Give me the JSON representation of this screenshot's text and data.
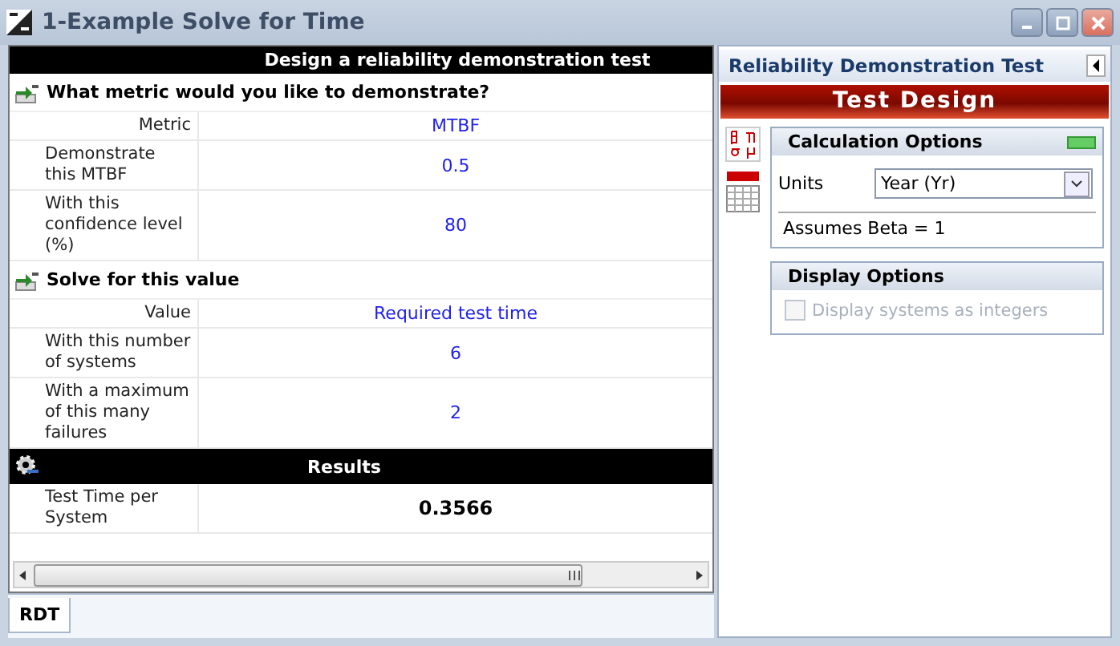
{
  "window": {
    "title": "1-Example Solve for Time"
  },
  "grid": {
    "header": "Design a reliability demonstration test",
    "sections": [
      {
        "kind": "section",
        "title": "What metric would you like to demonstrate?",
        "rows": [
          {
            "label": "Metric",
            "value": "MTBF"
          },
          {
            "label": "Demonstrate this MTBF",
            "value": "0.5"
          },
          {
            "label": "With this confidence level (%)",
            "value": "80"
          }
        ]
      },
      {
        "kind": "section",
        "title": "Solve for this value",
        "rows": [
          {
            "label": "Value",
            "value": "Required test time"
          },
          {
            "label": "With this number of systems",
            "value": "6"
          },
          {
            "label": "With a maximum of this many failures",
            "value": "2"
          }
        ]
      },
      {
        "kind": "results",
        "title": "Results",
        "rows": [
          {
            "label": "Test Time per System",
            "value": "0.3566"
          }
        ]
      }
    ]
  },
  "tabs": [
    {
      "label": "RDT",
      "selected": true
    }
  ],
  "panel": {
    "title": "Reliability Demonstration Test",
    "banner": "Test Design",
    "calculation_options": {
      "title": "Calculation Options",
      "units_label": "Units",
      "units_value": "Year (Yr)",
      "note": "Assumes Beta = 1"
    },
    "display_options": {
      "title": "Display Options",
      "checkbox": {
        "label": "Display systems as integers",
        "checked": false,
        "disabled": true
      }
    }
  }
}
